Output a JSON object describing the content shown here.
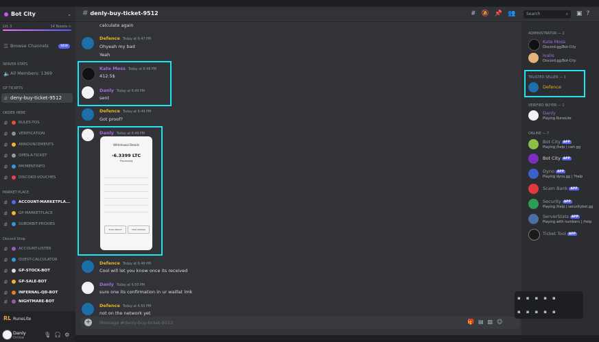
{
  "server": {
    "name": "Bot City",
    "boost_label": "LVL 3",
    "boost_count": "14 Boosts >"
  },
  "sidebar": {
    "browse": "Browse Channels",
    "new_badge": "NEW",
    "stats_cat": "SERVER STATS",
    "members_count": "All Members: 1369",
    "gp_cat": "GP TICKETS",
    "active_channel": "deny-buy-ticket-9512",
    "order_cat": "ORDER HERE",
    "channels_a": [
      "RULES-TOS",
      "VERIFICATION",
      "ANNOUNCEMENTS",
      "OPEN-A-TICKET",
      "PAYMENTINFO",
      "DISCORD-VOUCHES"
    ],
    "market_cat": "MARKET PLACE",
    "channels_b": [
      "ACCOUNT-MARKETPLA...",
      "GP-MARKETPLACE",
      "SUBORBIT-PROXIES"
    ],
    "shop_cat": "Discord Shop",
    "channels_c": [
      "ACCOUNT-LISTER",
      "QUEST-CALCULATOR",
      "GP-STOCK-BOT",
      "GP-SALE-BOT",
      "INFERNAL-QD-BOT",
      "NIGHTMARE-BOT"
    ]
  },
  "user_panel": {
    "activity": "RuneLite",
    "name": "Danly",
    "status": "Online"
  },
  "topbar": {
    "channel": "denly-buy-ticket-9512",
    "search_placeholder": "Search"
  },
  "messages": [
    {
      "author": "",
      "time": "",
      "text": "calculate again"
    },
    {
      "author": "Defence",
      "time": "Today at 6:47 PM",
      "text": "Ohyeah my bad",
      "text2": "Yeah"
    },
    {
      "author": "Kate Moss",
      "time": "Today at 6:48 PM",
      "text": "412.5$"
    },
    {
      "author": "Danly",
      "time": "Today at 6:49 PM",
      "text": "sent"
    },
    {
      "author": "Defence",
      "time": "Today at 6:49 PM",
      "text": "Got proof?"
    },
    {
      "author": "Danly",
      "time": "Today at 6:49 PM",
      "text": ""
    },
    {
      "author": "Defence",
      "time": "Today at 6:49 PM",
      "text": "Cool will let you know once its received"
    },
    {
      "author": "Danly",
      "time": "Today at 6:50 PM",
      "text": "sure one its confirmation in ur waillat lmk"
    },
    {
      "author": "Defence",
      "time": "Today at 6:50 PM",
      "text": "not on the network yet"
    }
  ],
  "receipt": {
    "title": "Withdrawal Details",
    "amount": "-6.3399 LTC",
    "status": "Processing",
    "btn1": "Scam Report",
    "btn2": "View Address"
  },
  "composer": {
    "placeholder": "Message #denly-buy-ticket-9512"
  },
  "member_list": {
    "admin_cat": "ADMINISTRATOR — 2",
    "admins": [
      {
        "name": "Kate Moss",
        "activity": "Discord.gg/Bot-City"
      },
      {
        "name": "Ivalis",
        "activity": "Discord.gg/Bot-City"
      }
    ],
    "trusted_cat": "TRUSTED SELLER — 1",
    "trusted": [
      {
        "name": "Defence"
      }
    ],
    "verified_cat": "VERIFIED BUYER — 1",
    "verified": [
      {
        "name": "Danly",
        "activity": "Playing RuneLite"
      }
    ],
    "online_cat": "ONLINE — 7",
    "online": [
      {
        "name": "Bot City",
        "activity": "Playing /help | cart.gg",
        "app": "APP"
      },
      {
        "name": "Bot City",
        "activity": "",
        "app": "APP"
      },
      {
        "name": "Dyno",
        "activity": "Playing dyno.gg | ?help",
        "app": "APP"
      },
      {
        "name": "Scam Bank",
        "activity": "",
        "app": "APP"
      },
      {
        "name": "Security",
        "activity": "Playing /help | securitybot.gg",
        "app": "APP"
      },
      {
        "name": "ServerStats",
        "activity": "Playing with numbers | /help",
        "app": "APP"
      },
      {
        "name": "Ticket Tool",
        "activity": "",
        "app": "APP"
      }
    ]
  },
  "colors": {
    "accent_highlight": "#22e3f0",
    "defence": "#e8b823",
    "danly": "#a66ee0",
    "kate": "#a66ee0",
    "app_badge": "#5865f2"
  }
}
